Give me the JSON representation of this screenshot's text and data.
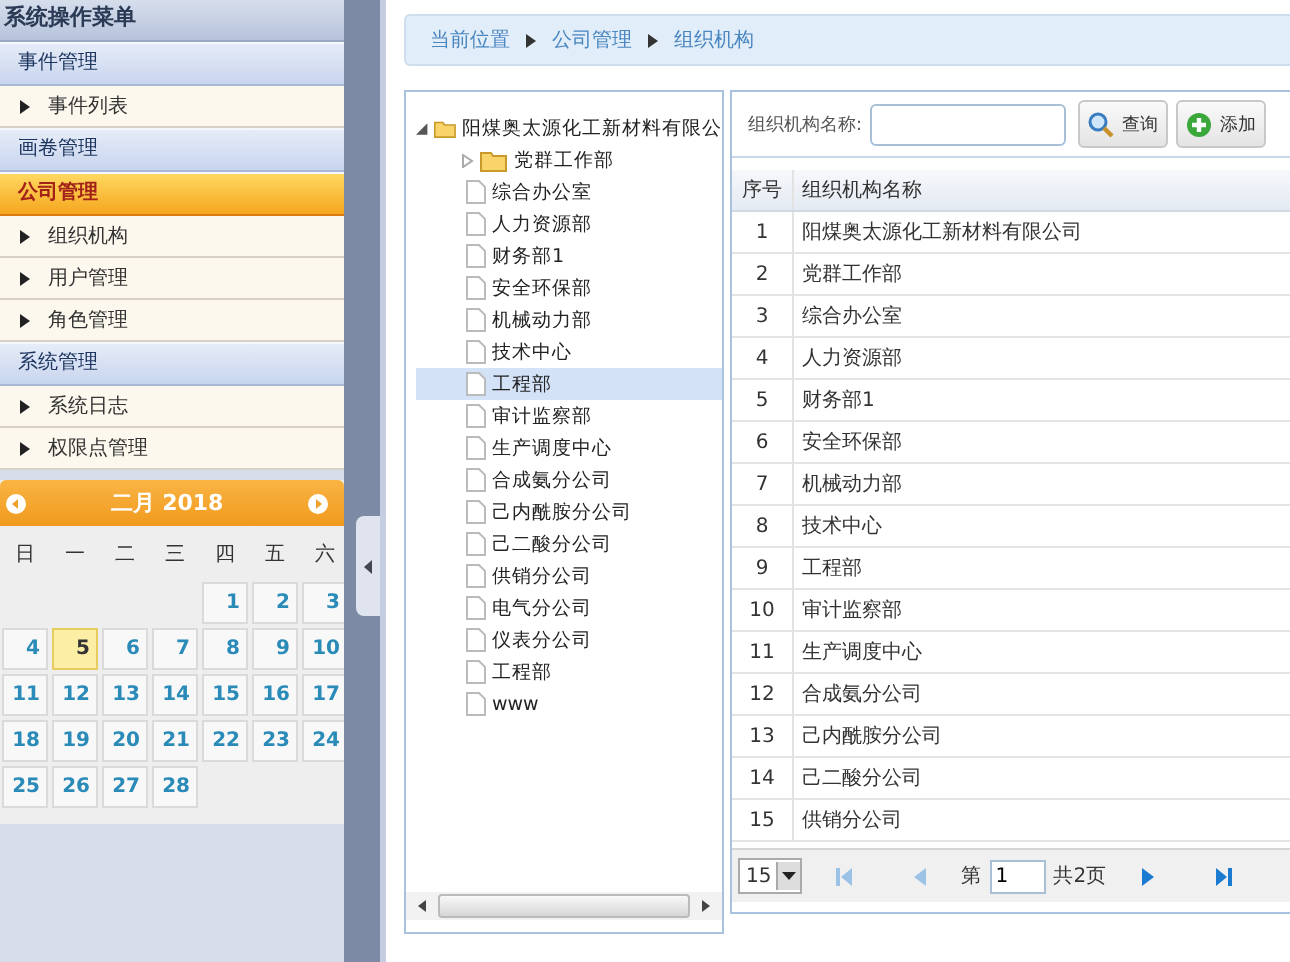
{
  "sidebar": {
    "title": "系统操作菜单",
    "groups": [
      {
        "label": "事件管理",
        "selected": false,
        "items": [
          {
            "label": "事件列表"
          }
        ]
      },
      {
        "label": "画卷管理",
        "selected": false
      },
      {
        "label": "公司管理",
        "selected": true,
        "items": [
          {
            "label": "组织机构"
          },
          {
            "label": "用户管理"
          },
          {
            "label": "角色管理"
          }
        ]
      },
      {
        "label": "系统管理",
        "selected": false,
        "items": [
          {
            "label": "系统日志"
          },
          {
            "label": "权限点管理"
          }
        ]
      }
    ]
  },
  "calendar": {
    "title": "二月 2018",
    "weekdays": [
      "日",
      "一",
      "二",
      "三",
      "四",
      "五",
      "六"
    ],
    "days": [
      {
        "label": "1",
        "selected": false
      },
      {
        "label": "2",
        "selected": false
      },
      {
        "label": "3",
        "selected": false
      },
      {
        "label": "4",
        "selected": false
      },
      {
        "label": "5",
        "selected": true
      },
      {
        "label": "6",
        "selected": false
      },
      {
        "label": "7",
        "selected": false
      },
      {
        "label": "8",
        "selected": false
      },
      {
        "label": "9",
        "selected": false
      },
      {
        "label": "10",
        "selected": false
      },
      {
        "label": "11",
        "selected": false
      },
      {
        "label": "12",
        "selected": false
      },
      {
        "label": "13",
        "selected": false
      },
      {
        "label": "14",
        "selected": false
      },
      {
        "label": "15",
        "selected": false
      },
      {
        "label": "16",
        "selected": false
      },
      {
        "label": "17",
        "selected": false
      },
      {
        "label": "18",
        "selected": false
      },
      {
        "label": "19",
        "selected": false
      },
      {
        "label": "20",
        "selected": false
      },
      {
        "label": "21",
        "selected": false
      },
      {
        "label": "22",
        "selected": false
      },
      {
        "label": "23",
        "selected": false
      },
      {
        "label": "24",
        "selected": false
      },
      {
        "label": "25",
        "selected": false
      },
      {
        "label": "26",
        "selected": false
      },
      {
        "label": "27",
        "selected": false
      },
      {
        "label": "28",
        "selected": false
      }
    ]
  },
  "breadcrumb": [
    "当前位置",
    "公司管理",
    "组织机构"
  ],
  "tree": {
    "root": {
      "label": "阳煤奥太源化工新材料有限公",
      "kind": "folder",
      "expanded": true,
      "selected": false,
      "children": [
        {
          "label": "党群工作部",
          "kind": "folder",
          "expanded": false,
          "selected": false
        },
        {
          "label": "综合办公室",
          "kind": "file",
          "selected": false
        },
        {
          "label": "人力资源部",
          "kind": "file",
          "selected": false
        },
        {
          "label": "财务部1",
          "kind": "file",
          "selected": false
        },
        {
          "label": "安全环保部",
          "kind": "file",
          "selected": false
        },
        {
          "label": "机械动力部",
          "kind": "file",
          "selected": false
        },
        {
          "label": "技术中心",
          "kind": "file",
          "selected": false
        },
        {
          "label": "工程部",
          "kind": "file",
          "selected": true
        },
        {
          "label": "审计监察部",
          "kind": "file",
          "selected": false
        },
        {
          "label": "生产调度中心",
          "kind": "file",
          "selected": false
        },
        {
          "label": "合成氨分公司",
          "kind": "file",
          "selected": false
        },
        {
          "label": "己内酰胺分公司",
          "kind": "file",
          "selected": false
        },
        {
          "label": "己二酸分公司",
          "kind": "file",
          "selected": false
        },
        {
          "label": "供销分公司",
          "kind": "file",
          "selected": false
        },
        {
          "label": "电气分公司",
          "kind": "file",
          "selected": false
        },
        {
          "label": "仪表分公司",
          "kind": "file",
          "selected": false
        },
        {
          "label": "工程部",
          "kind": "file",
          "selected": false
        },
        {
          "label": "www",
          "kind": "file",
          "selected": false
        }
      ]
    }
  },
  "search": {
    "label": "组织机构名称:",
    "search_button": "查询",
    "add_button": "添加"
  },
  "table": {
    "columns": [
      "序号",
      "组织机构名称"
    ],
    "rows": [
      [
        "1",
        "阳煤奥太源化工新材料有限公司"
      ],
      [
        "2",
        "党群工作部"
      ],
      [
        "3",
        "综合办公室"
      ],
      [
        "4",
        "人力资源部"
      ],
      [
        "5",
        "财务部1"
      ],
      [
        "6",
        "安全环保部"
      ],
      [
        "7",
        "机械动力部"
      ],
      [
        "8",
        "技术中心"
      ],
      [
        "9",
        "工程部"
      ],
      [
        "10",
        "审计监察部"
      ],
      [
        "11",
        "生产调度中心"
      ],
      [
        "12",
        "合成氨分公司"
      ],
      [
        "13",
        "己内酰胺分公司"
      ],
      [
        "14",
        "己二酸分公司"
      ],
      [
        "15",
        "供销分公司"
      ]
    ]
  },
  "pager": {
    "page_size": "15",
    "page_label": "第",
    "page": "1",
    "total": "共2页",
    "first_disabled": true,
    "prev_disabled": true,
    "next_disabled": false,
    "last_disabled": false
  }
}
